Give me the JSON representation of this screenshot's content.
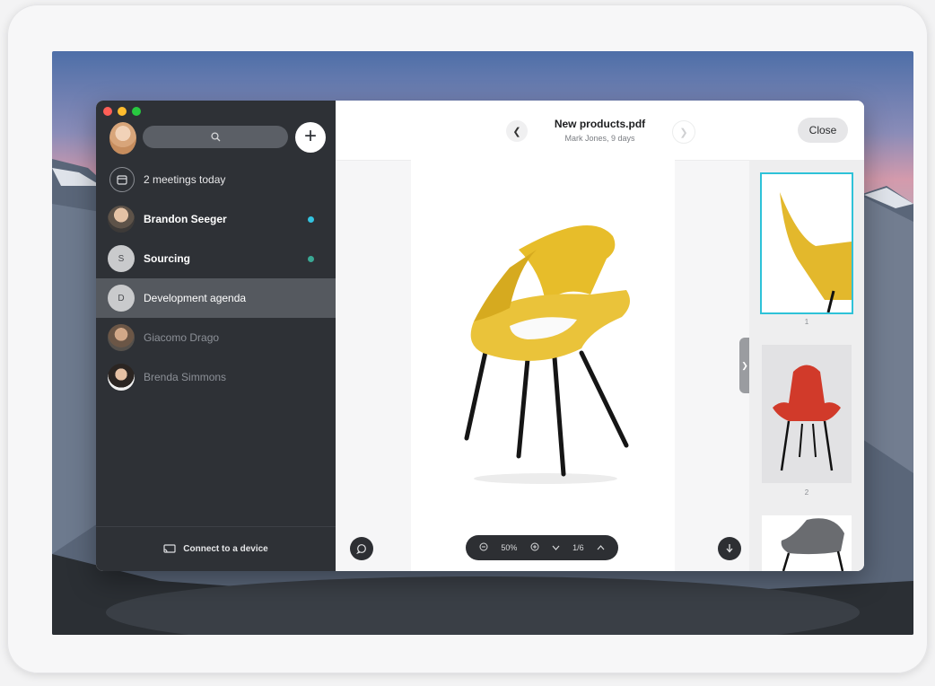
{
  "sidebar": {
    "search_icon": "search-icon",
    "new_button_label": "+",
    "items": [
      {
        "label": "2 meetings today",
        "icon": "calendar-icon",
        "style": "normal"
      },
      {
        "label": "Brandon Seeger",
        "style": "bold",
        "unread_color": "#33c3e0"
      },
      {
        "label": "Sourcing",
        "initial": "S",
        "style": "bold",
        "unread_color": "#3aa894"
      },
      {
        "label": "Development agenda",
        "initial": "D",
        "style": "active"
      },
      {
        "label": "Giacomo Drago",
        "style": "dim"
      },
      {
        "label": "Brenda Simmons",
        "style": "dim"
      }
    ],
    "footer_label": "Connect to a device"
  },
  "viewer": {
    "file_title": "New products.pdf",
    "file_meta": "Mark Jones, 9 days",
    "close_label": "Close",
    "prev_icon": "chevron-left-icon",
    "next_icon": "chevron-right-icon",
    "zoom_level": "50%",
    "page_indicator": "1/6",
    "thumbnails": [
      {
        "number": "1",
        "selected": true,
        "color": "#e7c02e"
      },
      {
        "number": "2",
        "selected": false,
        "color": "#d63a2a"
      },
      {
        "number": "",
        "selected": false,
        "color": "#6a6c70"
      }
    ]
  },
  "colors": {
    "accent": "#2ec2d8",
    "sidebar_bg": "#2e3136",
    "chair_yellow": "#eac33a"
  }
}
